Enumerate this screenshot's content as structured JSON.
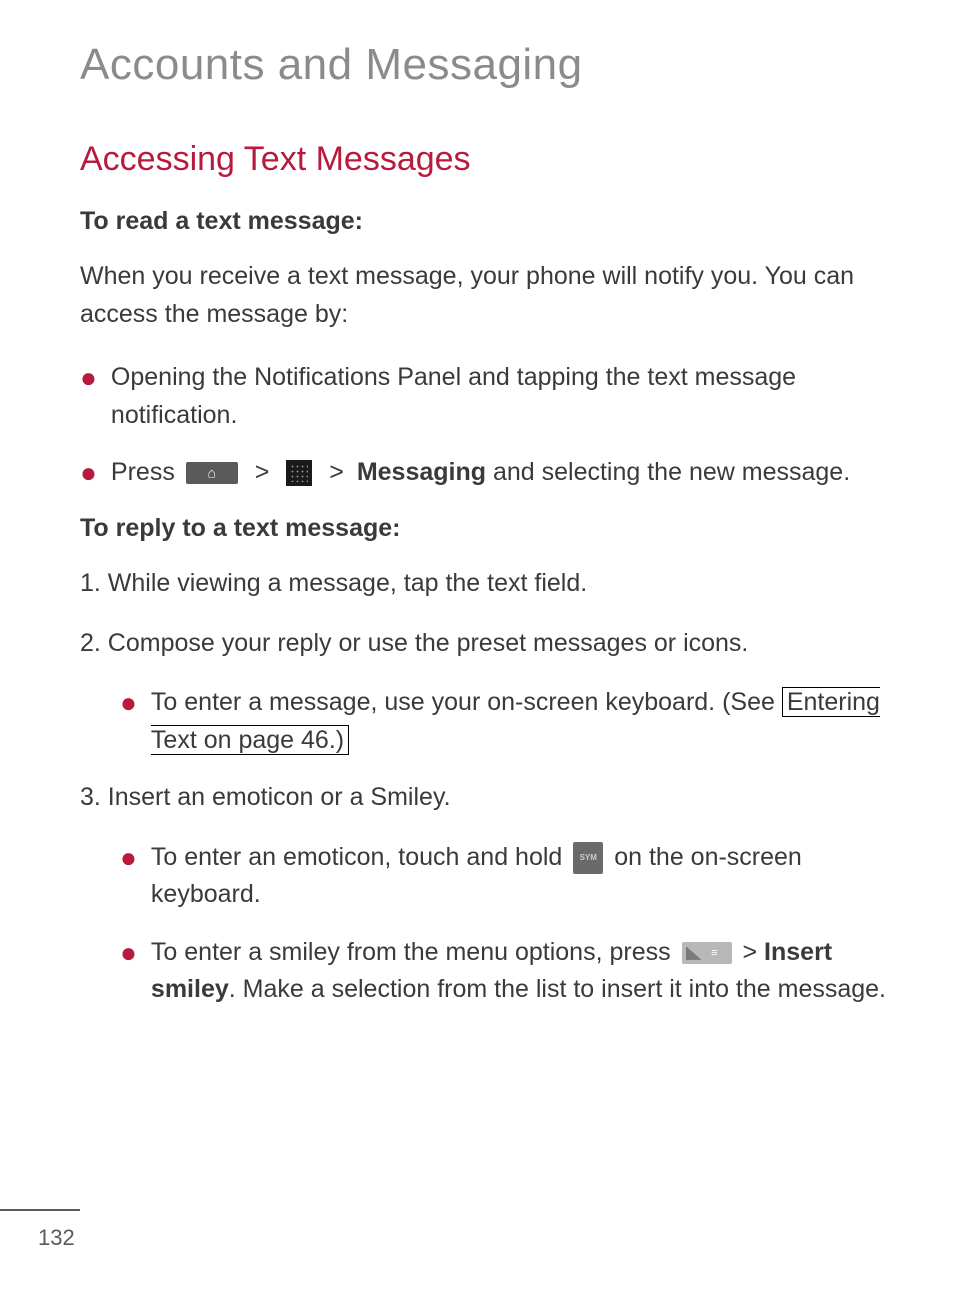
{
  "chapter_title": "Accounts and Messaging",
  "section_title": "Accessing Text Messages",
  "subheading_read": "To read a text message:",
  "intro_read": "When you receive a text message, your phone will notify you. You can access the message by:",
  "bullets_read": [
    "Opening the Notifications Panel and tapping the text message notification."
  ],
  "press_prefix": "Press ",
  "messaging_label": "Messaging",
  "press_suffix": " and selecting the new message.",
  "subheading_reply": "To reply to a text message:",
  "step1": "1. While viewing a message, tap the text field.",
  "step2": "2. Compose your reply or use the preset messages or icons.",
  "step2_sub_prefix": "To enter a message, use your on-screen keyboard. (See ",
  "step2_link": "Entering Text on page 46.)",
  "step3": "3. Insert an emoticon or a Smiley.",
  "step3_sub1_prefix": "To enter an emoticon, touch and hold ",
  "step3_sub1_suffix": " on the on-screen keyboard.",
  "step3_sub2_prefix": "To enter a smiley from the menu options, press ",
  "step3_sub2_mid": " > ",
  "insert_smiley": "Insert smiley",
  "step3_sub2_suffix": ". Make a selection from the list to insert it into the message.",
  "page_number": "132",
  "gt": ">"
}
